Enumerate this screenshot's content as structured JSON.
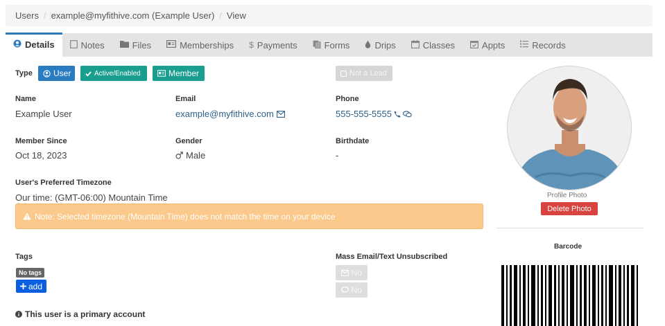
{
  "breadcrumb": {
    "items": [
      "Users",
      "example@myfithive.com (Example User)",
      "View"
    ]
  },
  "tabs": [
    {
      "label": "Details",
      "icon": "user-circle-icon",
      "active": true
    },
    {
      "label": "Notes",
      "icon": "note-icon"
    },
    {
      "label": "Files",
      "icon": "folder-icon"
    },
    {
      "label": "Memberships",
      "icon": "id-card-icon"
    },
    {
      "label": "Payments",
      "icon": "dollar-icon"
    },
    {
      "label": "Forms",
      "icon": "forms-icon"
    },
    {
      "label": "Drips",
      "icon": "drop-icon"
    },
    {
      "label": "Classes",
      "icon": "calendar-icon"
    },
    {
      "label": "Appts",
      "icon": "calendar-check-icon"
    },
    {
      "label": "Records",
      "icon": "list-icon"
    }
  ],
  "type": {
    "label": "Type",
    "user": "User",
    "active": "Active/Enabled",
    "member": "Member",
    "lead": "Not a Lead"
  },
  "fields": {
    "name_label": "Name",
    "name": "Example User",
    "email_label": "Email",
    "email": "example@myfithive.com",
    "phone_label": "Phone",
    "phone": "555-555-5555",
    "member_since_label": "Member Since",
    "member_since": "Oct 18, 2023",
    "gender_label": "Gender",
    "gender": "Male",
    "birthdate_label": "Birthdate",
    "birthdate": "-"
  },
  "timezone": {
    "label": "User's Preferred Timezone",
    "value": "Our time: (GMT-06:00) Mountain Time",
    "warning": "Note: Selected timezone (Mountain Time) does not match the time on your device"
  },
  "tags": {
    "label": "Tags",
    "none": "No tags",
    "add_label": "add"
  },
  "unsubscribe": {
    "label": "Mass Email/Text Unsubscribed",
    "email": "No",
    "text": "No"
  },
  "primary_note": "This user is a primary account",
  "photo": {
    "caption": "Profile Photo",
    "delete_label": "Delete Photo"
  },
  "barcode": {
    "label": "Barcode"
  },
  "colors": {
    "primary": "#2a7cc1",
    "teal": "#1a9e8f",
    "warning": "#fbc98b",
    "danger": "#d9433f"
  }
}
